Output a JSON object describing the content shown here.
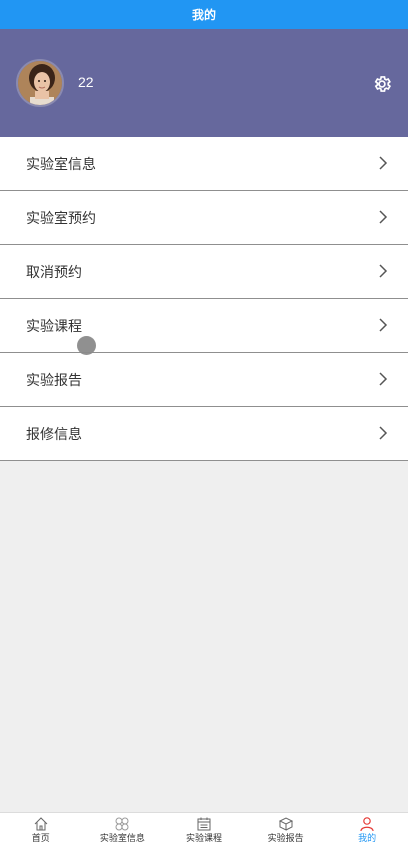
{
  "header": {
    "title": "我的"
  },
  "profile": {
    "username": "22"
  },
  "menu": {
    "items": [
      {
        "label": "实验室信息"
      },
      {
        "label": "实验室预约"
      },
      {
        "label": "取消预约"
      },
      {
        "label": "实验课程"
      },
      {
        "label": "实验报告"
      },
      {
        "label": "报修信息"
      }
    ]
  },
  "tabbar": {
    "tabs": [
      {
        "label": "首页",
        "icon": "home-icon"
      },
      {
        "label": "实验室信息",
        "icon": "clover-icon"
      },
      {
        "label": "实验课程",
        "icon": "calendar-icon"
      },
      {
        "label": "实验报告",
        "icon": "box-icon"
      },
      {
        "label": "我的",
        "icon": "person-icon",
        "active": true
      }
    ]
  },
  "colors": {
    "header_bg": "#2196f3",
    "profile_bg": "#66689d",
    "active_tab": "#2196f3",
    "active_icon": "#e53935"
  }
}
